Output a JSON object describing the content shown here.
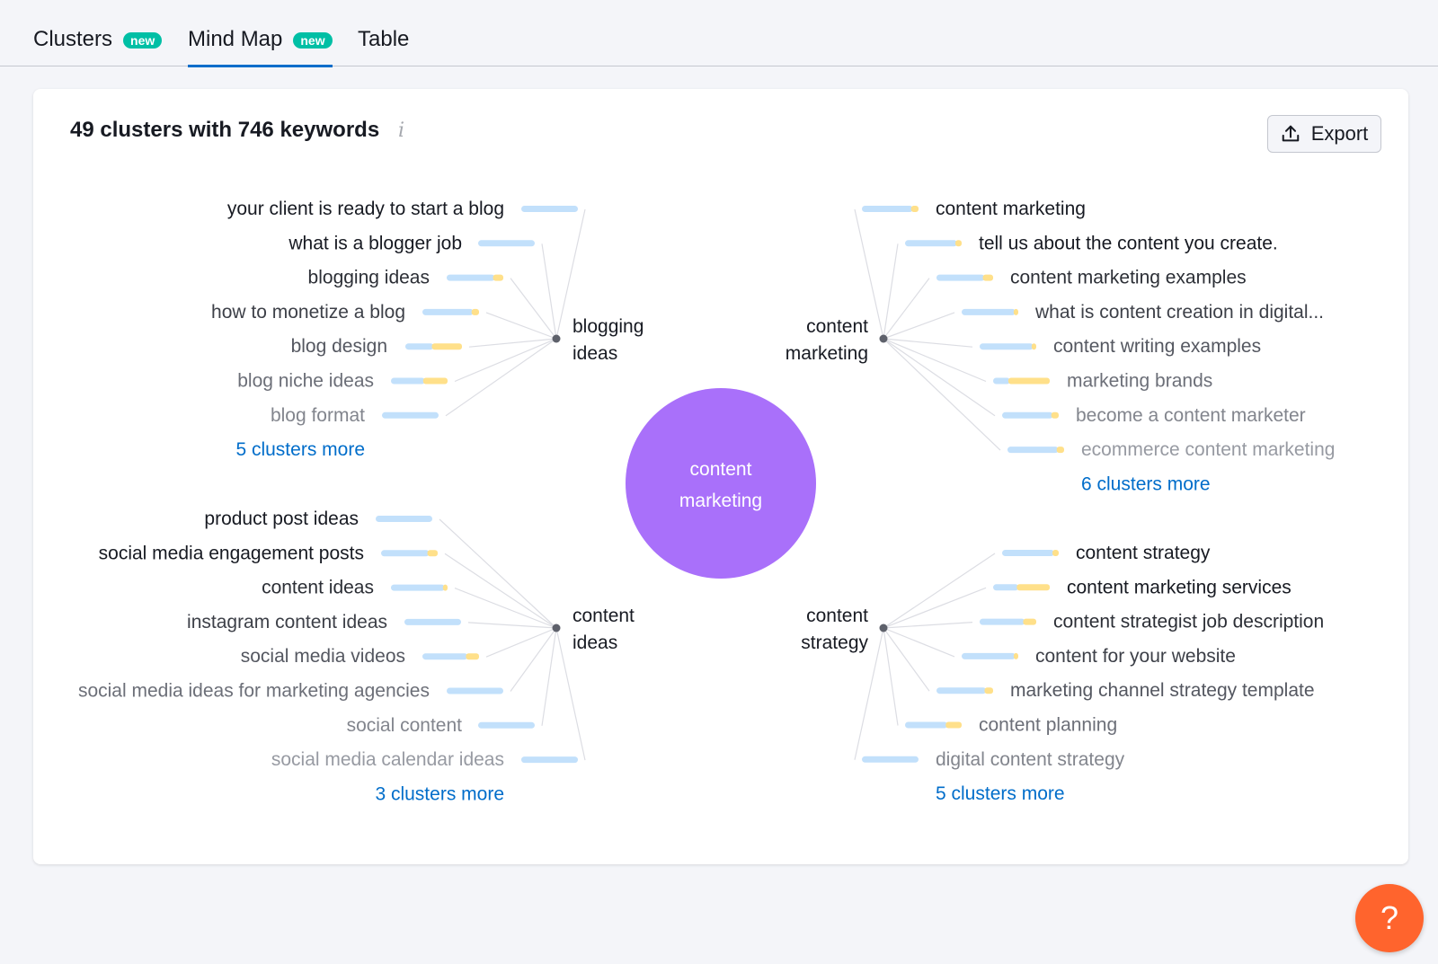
{
  "tabs": [
    {
      "label": "Clusters",
      "badge": "new",
      "active": false
    },
    {
      "label": "Mind Map",
      "badge": "new",
      "active": true
    },
    {
      "label": "Table",
      "badge": "",
      "active": false
    }
  ],
  "card": {
    "title": "49 clusters with 746 keywords",
    "info_icon": "info-icon",
    "export_label": "Export",
    "export_icon": "upload-icon"
  },
  "colors": {
    "accent": "#006dca",
    "center_node": "#a970fa",
    "badge": "#00bfa5",
    "bar_blue": "#c2e0fb",
    "bar_yellow": "#ffe08a",
    "help": "#ff642d"
  },
  "mind_map": {
    "center": [
      "content",
      "marketing"
    ],
    "clusters": [
      {
        "id": "blogging-ideas",
        "label": [
          "blogging",
          "ideas"
        ],
        "side": "left",
        "more": "5 clusters more",
        "keywords": [
          {
            "text": "your client is ready to start a blog",
            "blue": 1.0,
            "yellow": 0.0
          },
          {
            "text": "what is a blogger job",
            "blue": 1.0,
            "yellow": 0.0
          },
          {
            "text": "blogging ideas",
            "blue": 0.85,
            "yellow": 0.15
          },
          {
            "text": "how to monetize a blog",
            "blue": 0.9,
            "yellow": 0.1
          },
          {
            "text": "blog design",
            "blue": 0.5,
            "yellow": 0.5
          },
          {
            "text": "blog niche ideas",
            "blue": 0.6,
            "yellow": 0.4
          },
          {
            "text": "blog format",
            "blue": 1.0,
            "yellow": 0.0
          }
        ]
      },
      {
        "id": "content-marketing",
        "label": [
          "content",
          "marketing"
        ],
        "side": "right",
        "more": "6 clusters more",
        "keywords": [
          {
            "text": "content marketing",
            "blue": 0.9,
            "yellow": 0.1
          },
          {
            "text": "tell us about the content you create.",
            "blue": 0.92,
            "yellow": 0.08
          },
          {
            "text": "content marketing examples",
            "blue": 0.85,
            "yellow": 0.15
          },
          {
            "text": "what is content creation in digital...",
            "blue": 0.95,
            "yellow": 0.05
          },
          {
            "text": "content writing examples",
            "blue": 0.95,
            "yellow": 0.05
          },
          {
            "text": "marketing brands",
            "blue": 0.3,
            "yellow": 0.7
          },
          {
            "text": "become a content marketer",
            "blue": 0.9,
            "yellow": 0.1
          },
          {
            "text": "ecommerce content marketing",
            "blue": 0.9,
            "yellow": 0.1
          }
        ]
      },
      {
        "id": "content-ideas",
        "label": [
          "content",
          "ideas"
        ],
        "side": "left",
        "more": "3 clusters more",
        "keywords": [
          {
            "text": "product post ideas",
            "blue": 1.0,
            "yellow": 0.0
          },
          {
            "text": "social media engagement posts",
            "blue": 0.85,
            "yellow": 0.15
          },
          {
            "text": "content ideas",
            "blue": 0.95,
            "yellow": 0.05
          },
          {
            "text": "instagram content ideas",
            "blue": 1.0,
            "yellow": 0.0
          },
          {
            "text": "social media videos",
            "blue": 0.8,
            "yellow": 0.2
          },
          {
            "text": "social media ideas for marketing agencies",
            "blue": 1.0,
            "yellow": 0.0
          },
          {
            "text": "social content",
            "blue": 1.0,
            "yellow": 0.0
          },
          {
            "text": "social media calendar ideas",
            "blue": 1.0,
            "yellow": 0.0
          }
        ]
      },
      {
        "id": "content-strategy",
        "label": [
          "content",
          "strategy"
        ],
        "side": "right",
        "more": "5 clusters more",
        "keywords": [
          {
            "text": "content strategy",
            "blue": 0.92,
            "yellow": 0.08
          },
          {
            "text": "content marketing services",
            "blue": 0.45,
            "yellow": 0.55
          },
          {
            "text": "content strategist job description",
            "blue": 0.8,
            "yellow": 0.2
          },
          {
            "text": "content for your website",
            "blue": 0.95,
            "yellow": 0.05
          },
          {
            "text": "marketing channel strategy template",
            "blue": 0.88,
            "yellow": 0.12
          },
          {
            "text": "content planning",
            "blue": 0.75,
            "yellow": 0.25
          },
          {
            "text": "digital content strategy",
            "blue": 1.0,
            "yellow": 0.0
          }
        ]
      }
    ]
  },
  "help_label": "?"
}
